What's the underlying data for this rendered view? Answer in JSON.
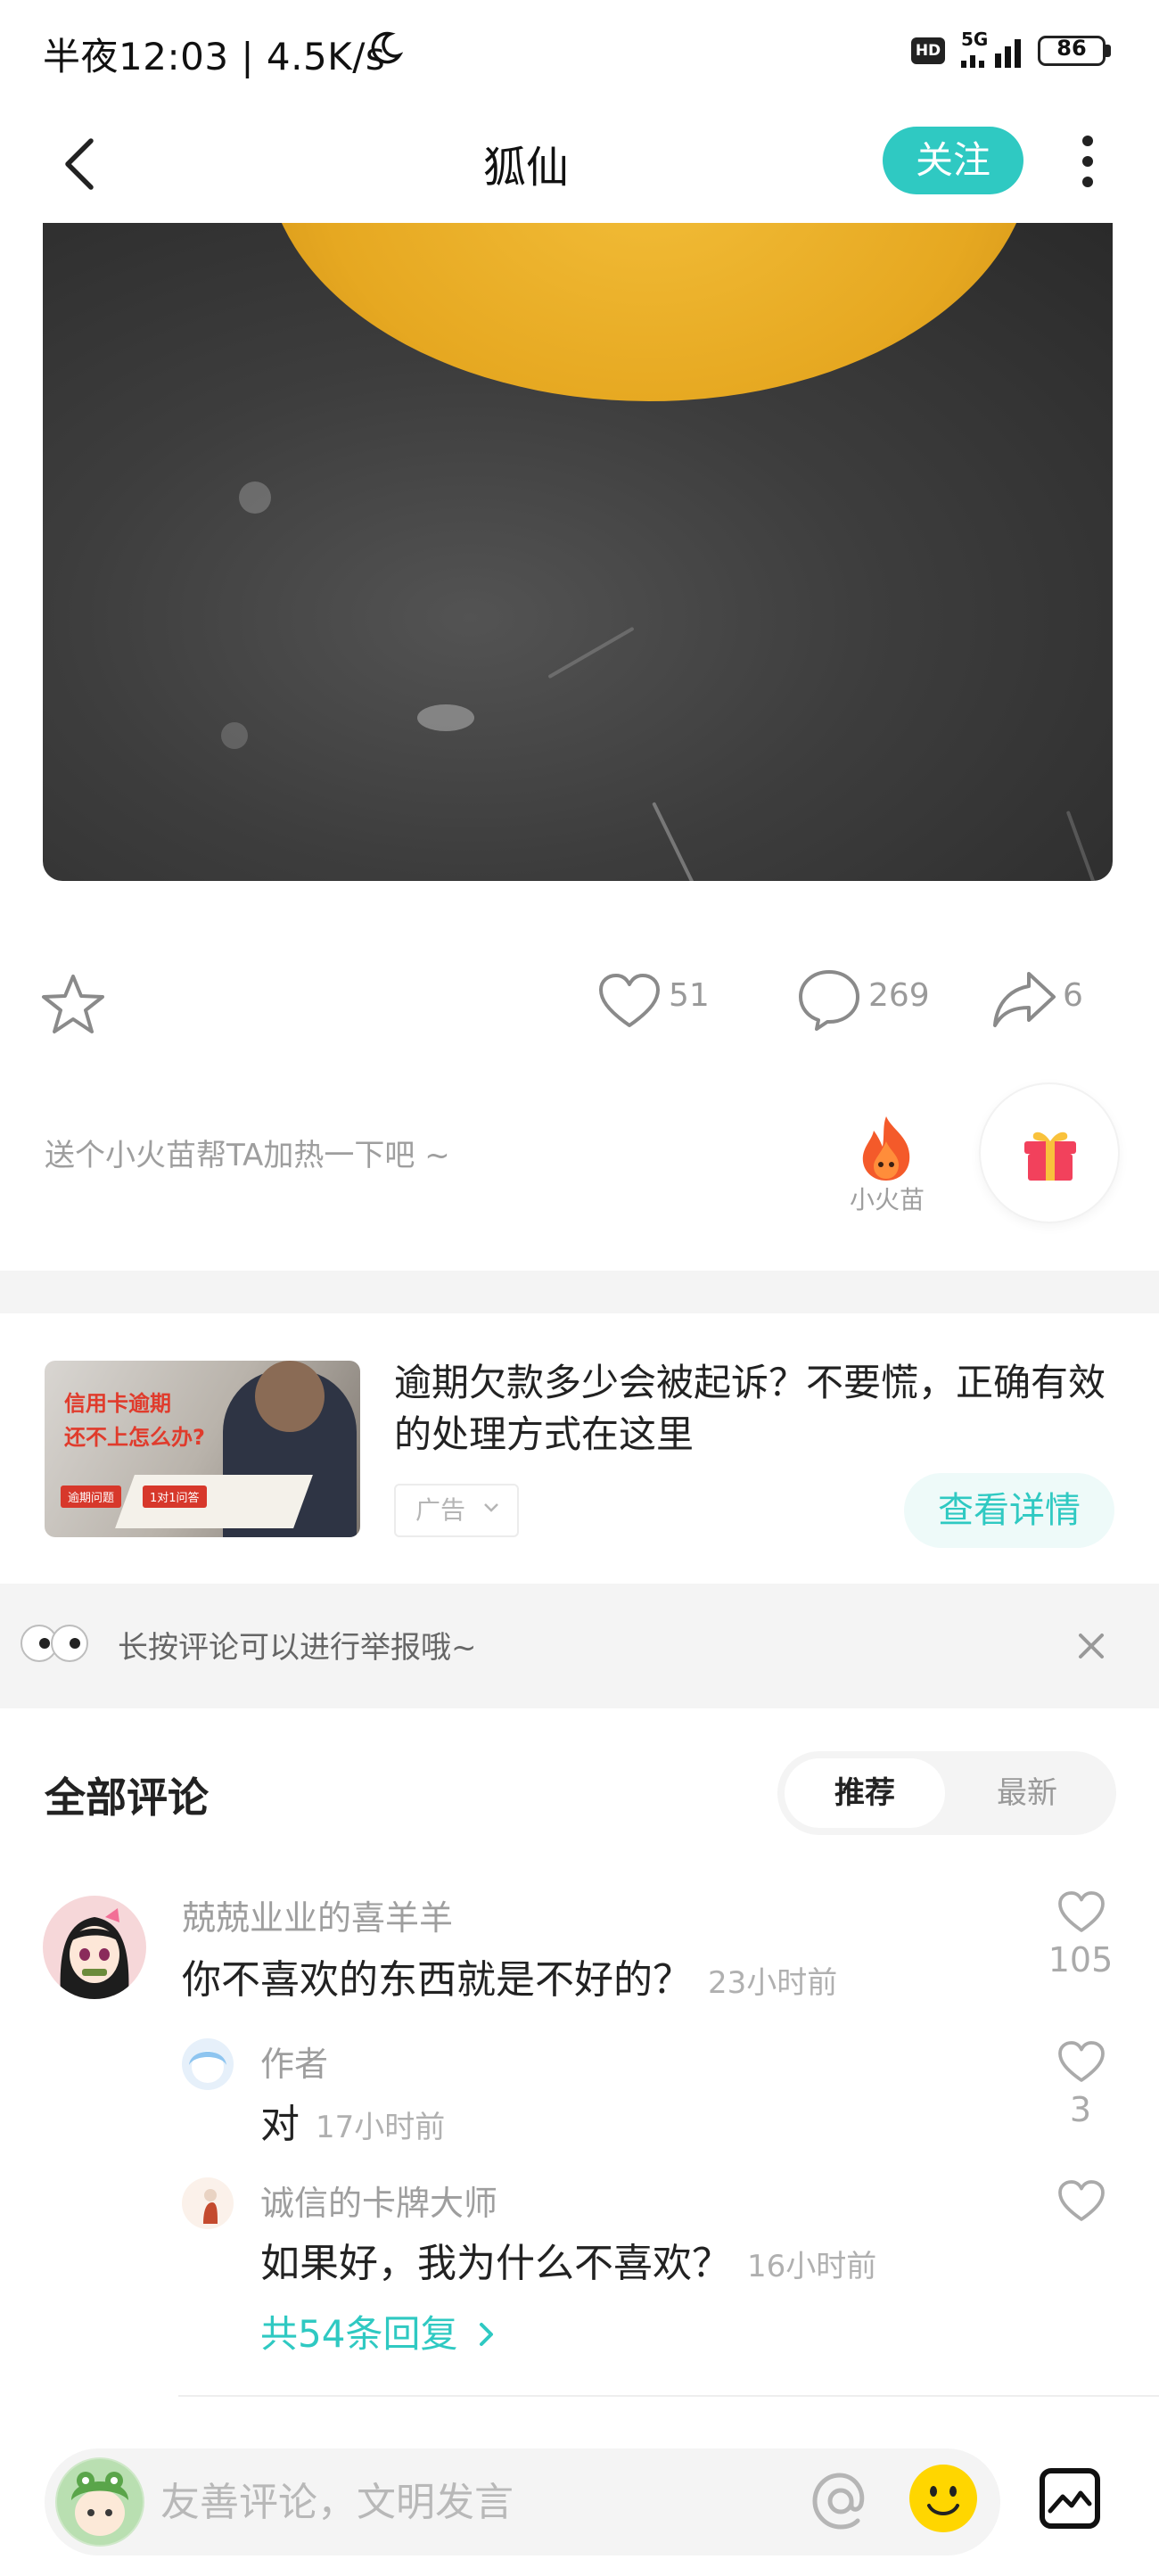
{
  "status_bar": {
    "time_speed": "半夜12:03 | 4.5K/s",
    "hd": "HD",
    "network": "5G",
    "battery": "86"
  },
  "header": {
    "title": "狐仙",
    "follow_label": "关注"
  },
  "actions": {
    "likes": "51",
    "comments": "269",
    "shares": "6"
  },
  "boost": {
    "text": "送个小火苗帮TA加热一下吧 ~",
    "flame_label": "小火苗"
  },
  "ad": {
    "title": "逾期欠款多少会被起诉？不要慌，正确有效的处理方式在这里",
    "tag": "广告",
    "detail_button": "查看详情",
    "image_text_1": "信用卡逾期",
    "image_text_2": "还不上怎么办?",
    "image_chip_1": "逾期问题",
    "image_chip_2": "1对1问答"
  },
  "tip": {
    "text": "长按评论可以进行举报哦~"
  },
  "comments": {
    "title": "全部评论",
    "sort_recommend": "推荐",
    "sort_latest": "最新",
    "items": [
      {
        "user": "兢兢业业的喜羊羊",
        "text": "你不喜欢的东西就是不好的？",
        "time": "23小时前",
        "likes": "105"
      }
    ],
    "replies": [
      {
        "user": "作者",
        "text": "对",
        "time": "17小时前",
        "likes": "3"
      },
      {
        "user": "诚信的卡牌大师",
        "text": "如果好，我为什么不喜欢？",
        "time": "16小时前",
        "likes": ""
      }
    ],
    "more_replies": "共54条回复"
  },
  "input": {
    "placeholder": "友善评论，文明发言"
  },
  "colors": {
    "accent": "#2fc9c2",
    "text_primary": "#222222",
    "text_secondary": "#9e9e9e",
    "band": "#f4f4f4"
  }
}
